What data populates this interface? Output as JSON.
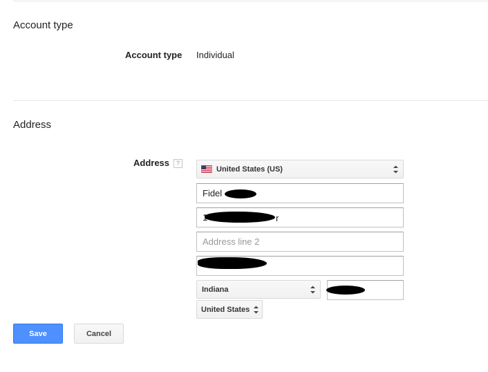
{
  "account_section": {
    "title": "Account type",
    "label": "Account type",
    "value": "Individual"
  },
  "address_section": {
    "title": "Address",
    "label": "Address",
    "help_glyph": "?",
    "country_select": "United States (US)",
    "name_value": "Fidel",
    "street_value": "1",
    "street_suffix": "r",
    "address_line2_placeholder": "Address line 2",
    "city_value": "",
    "state_select": "Indiana",
    "zip_value": "",
    "country_bottom_select": "United States"
  },
  "actions": {
    "save_label": "Save",
    "cancel_label": "Cancel"
  },
  "icons": {
    "flag": "us-flag-icon",
    "select_arrows": "chevron-updown-icon",
    "help": "help-icon"
  },
  "colors": {
    "primary_button": "#4d90fe",
    "divider": "#e5e5e5"
  }
}
